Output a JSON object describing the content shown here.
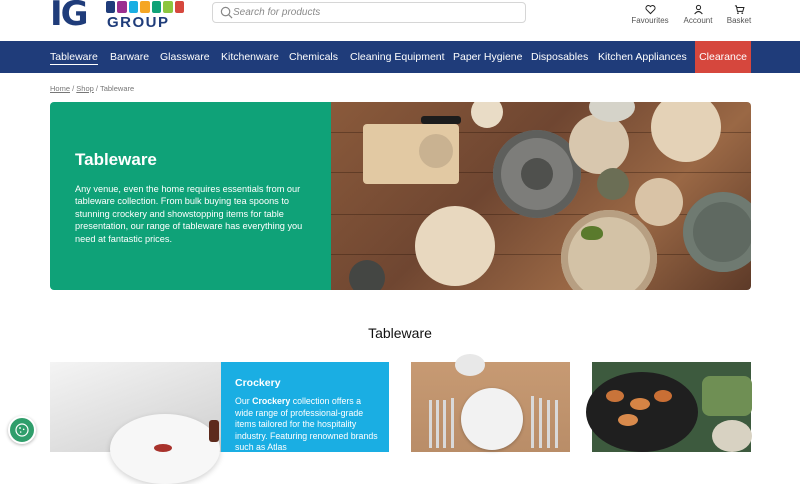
{
  "header": {
    "logo_main": "IG",
    "logo_sub": "GROUP",
    "search_placeholder": "Search for products",
    "util": [
      {
        "label": "Favourites",
        "icon": "heart-icon"
      },
      {
        "label": "Account",
        "icon": "user-icon"
      },
      {
        "label": "Basket",
        "icon": "basket-icon"
      }
    ]
  },
  "nav": {
    "items": [
      {
        "label": "Tableware",
        "active": true
      },
      {
        "label": "Barware"
      },
      {
        "label": "Glassware"
      },
      {
        "label": "Kitchenware"
      },
      {
        "label": "Chemicals"
      },
      {
        "label": "Cleaning Equipment"
      },
      {
        "label": "Paper Hygiene"
      },
      {
        "label": "Disposables"
      },
      {
        "label": "Kitchen Appliances"
      }
    ],
    "clearance": "Clearance",
    "clearance_color": "#d6473d",
    "bar_color": "#1f3c7a"
  },
  "breadcrumb": {
    "home": "Home",
    "shop": "Shop",
    "current": "Tableware",
    "sep": "/"
  },
  "hero": {
    "title": "Tableware",
    "text": "Any venue, even the home requires essentials from our tableware collection. From bulk buying tea spoons to stunning crockery and showstopping items for table presentation, our range of tableware has everything you need at fantastic prices.",
    "color": "#0fa278"
  },
  "section": {
    "title": "Tableware"
  },
  "cards": {
    "crockery": {
      "title": "Crockery",
      "text_pre": "Our ",
      "text_bold": "Crockery",
      "text_post": " collection offers a wide range of professional-grade items tailored for the hospitality industry. Featuring renowned brands such as Atlas",
      "color": "#1aaee3"
    }
  }
}
